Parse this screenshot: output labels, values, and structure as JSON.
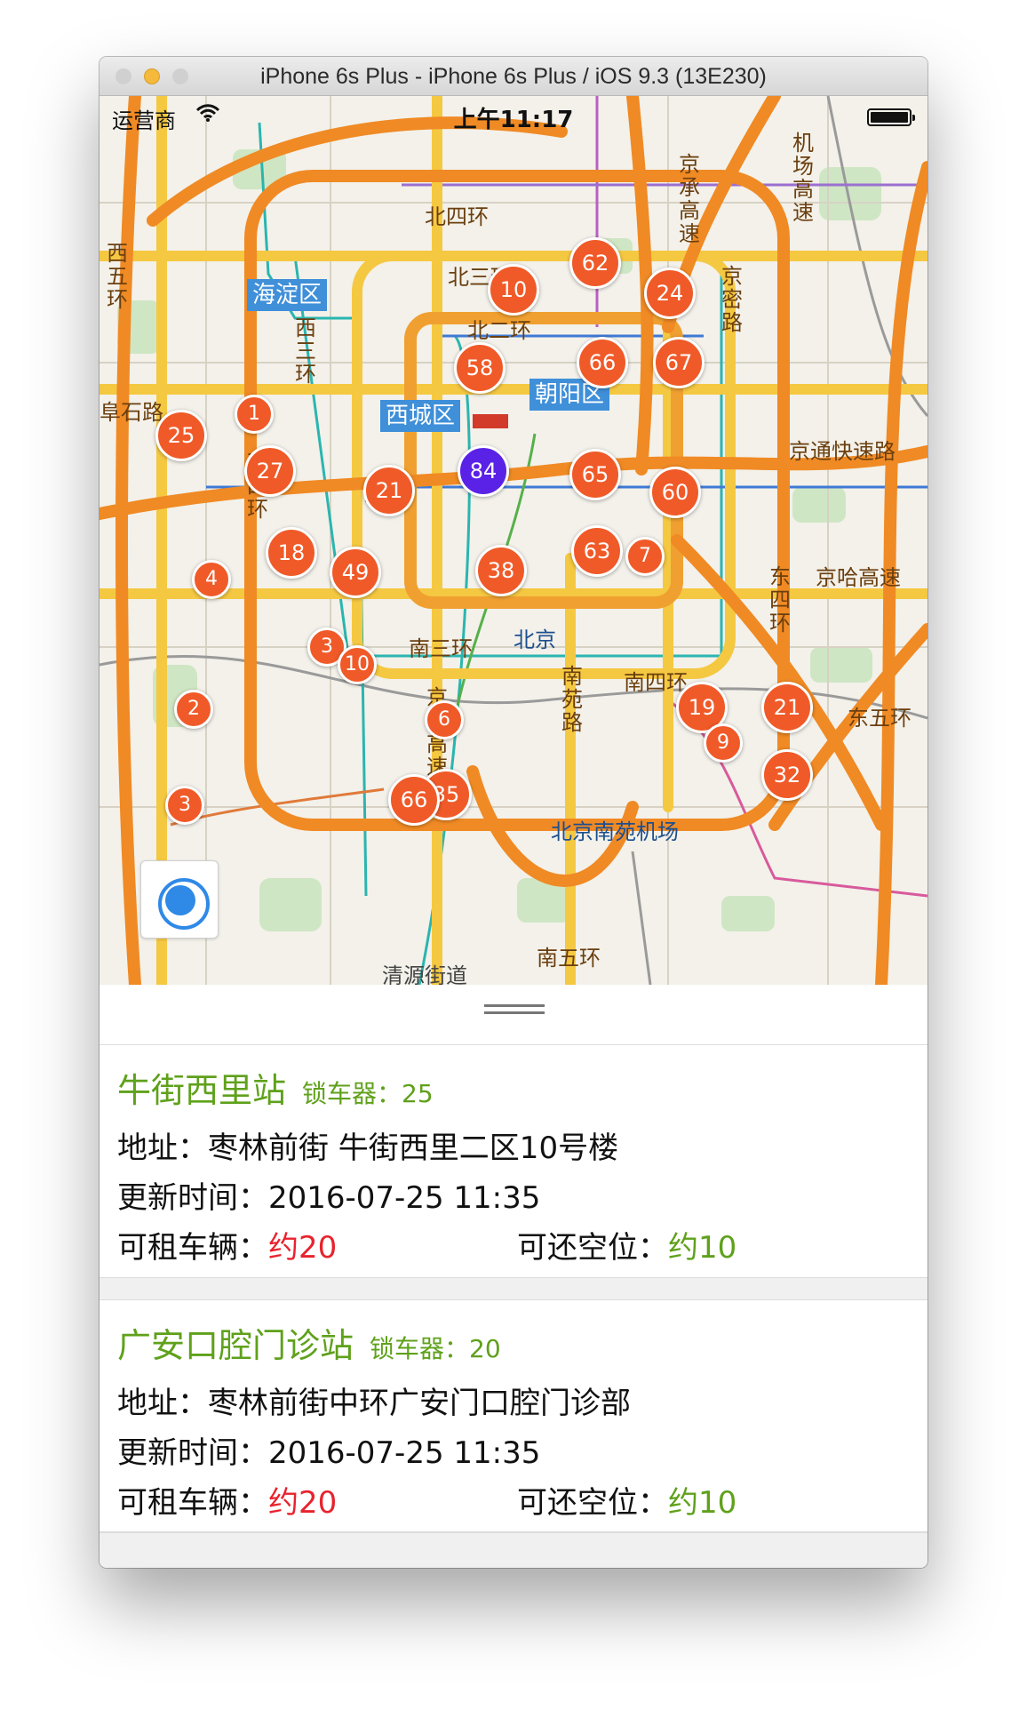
{
  "window": {
    "title": "iPhone 6s Plus - iPhone 6s Plus / iOS 9.3 (13E230)"
  },
  "status_bar": {
    "carrier": "运营商",
    "time": "上午11:17"
  },
  "map": {
    "districts": [
      "海淀区",
      "西城区",
      "朝阳区"
    ],
    "road_labels": [
      "北四环",
      "北三环",
      "北二环",
      "西五环",
      "西三环",
      "西四环",
      "京通快速路",
      "京哈高速",
      "东四环",
      "东五环",
      "南三环",
      "南四环",
      "南五环",
      "南苑路",
      "京开高速",
      "京承高速",
      "机场高速",
      "阜石路",
      "京密路",
      "清源街道"
    ],
    "pois": [
      "北京",
      "北京",
      "北京南苑机场"
    ],
    "clusters": [
      "62",
      "10",
      "24",
      "66",
      "58",
      "67",
      "1",
      "25",
      "27",
      "84",
      "65",
      "21",
      "60",
      "18",
      "49",
      "63",
      "7",
      "38",
      "4",
      "3",
      "10",
      "2",
      "6",
      "19",
      "21",
      "9",
      "32",
      "3",
      "66",
      "35"
    ],
    "selected_cluster": "84"
  },
  "stations": [
    {
      "name": "牛街西里站",
      "lock_label": "锁车器：",
      "lock_count": "25",
      "address_label": "地址：",
      "address": "枣林前街 牛街西里二区10号楼",
      "time_label": "更新时间：",
      "updated": "2016-07-25 11:35",
      "avail_label": "可租车辆：",
      "avail": "约20",
      "return_label": "可还空位：",
      "return": "约10"
    },
    {
      "name": "广安口腔门诊站",
      "lock_label": "锁车器：",
      "lock_count": "20",
      "address_label": "地址：",
      "address": "枣林前街中环广安门口腔门诊部",
      "time_label": "更新时间：",
      "updated": "2016-07-25 11:35",
      "avail_label": "可租车辆：",
      "avail": "约20",
      "return_label": "可还空位：",
      "return": "约10"
    }
  ],
  "colors": {
    "cluster": "#f05a28",
    "cluster_selected": "#5a22e6",
    "station_name": "#5fa11b",
    "avail": "#e8232d",
    "return": "#5fa11b"
  }
}
